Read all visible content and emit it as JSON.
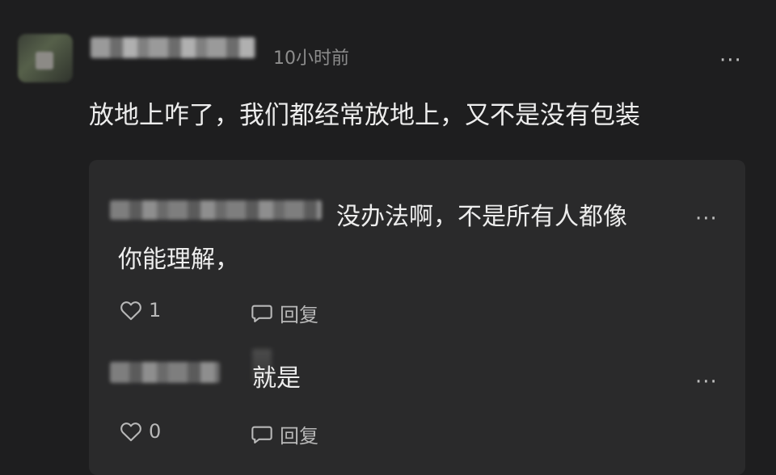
{
  "comment": {
    "time": "10小时前",
    "more": "···",
    "text": "放地上咋了，我们都经常放地上，又不是没有包装"
  },
  "replies": [
    {
      "text_line1": "没办法啊，不是所有人都像",
      "text_line2": "你能理解，",
      "more": "···",
      "likes": "1",
      "reply_label": "回复"
    },
    {
      "text": "就是",
      "more": "···",
      "likes": "0",
      "reply_label": "回复"
    }
  ]
}
